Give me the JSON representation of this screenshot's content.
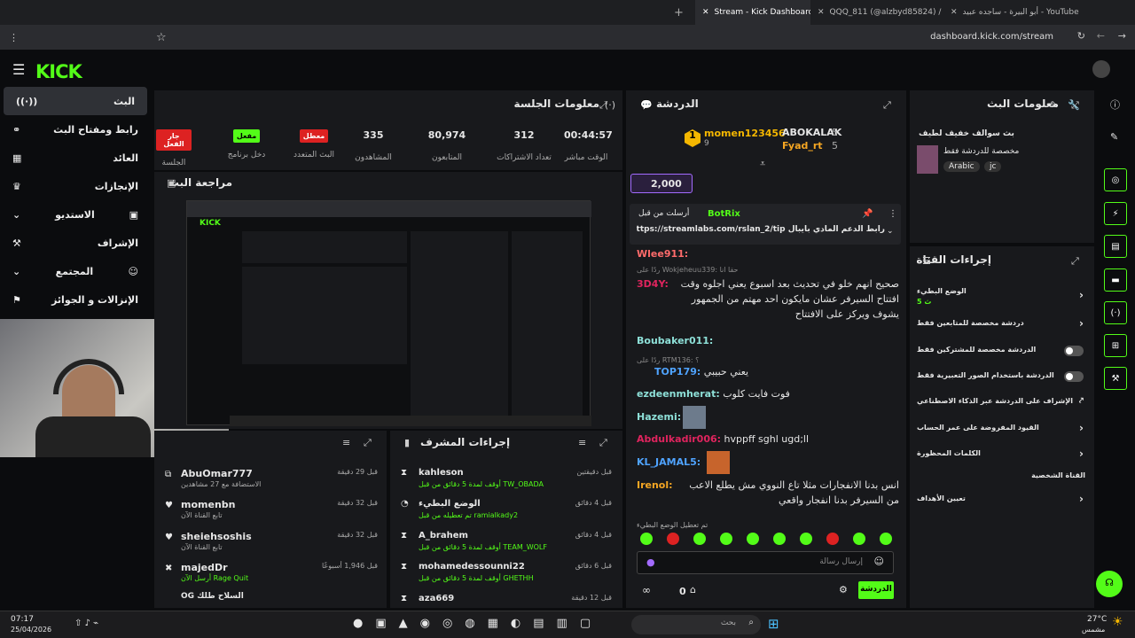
{
  "browser": {
    "tabs": [
      {
        "label": "أبو البيرة - ساجده عبيد - YouTube"
      },
      {
        "label": "QQQ_811 (@alzbyd85824) / X"
      },
      {
        "label": "Stream - Kick Dashboard"
      }
    ],
    "url": "dashboard.kick.com/stream"
  },
  "nav": [
    {
      "label": "البث"
    },
    {
      "label": "رابط ومفتاح البث"
    },
    {
      "label": "العائد"
    },
    {
      "label": "الإنجازات"
    },
    {
      "label": "الاستديو"
    },
    {
      "label": "الإشراف"
    },
    {
      "label": "المجتمع"
    },
    {
      "label": "الإنزالات و الجوائز"
    }
  ],
  "session": {
    "title": "معلومات الجلسة",
    "stats": [
      {
        "value": "00:44:57",
        "label": "الوقت مباشر"
      },
      {
        "value": "312",
        "label": "تعداد الاشتراكات"
      },
      {
        "value": "80,974",
        "label": "المتابعون"
      },
      {
        "value": "335",
        "label": "المشاهدون"
      },
      {
        "badge": "معطل",
        "label": "البث المتعدد"
      },
      {
        "badge": "مفعل",
        "label": "دخل برنامج"
      },
      {
        "badge": "جار الفعل",
        "label": "الجلسة"
      }
    ]
  },
  "preview": {
    "title": "مراجعة البث"
  },
  "activity": [
    {
      "name": "AbuOmar777",
      "time": "قبل 29 دقيقة",
      "detail": "الاستضافة مع 27 مشاهدين"
    },
    {
      "name": "momenbn",
      "time": "قبل 32 دقيقة",
      "detail": "تابع القناة الآن"
    },
    {
      "name": "sheiehsoshis",
      "time": "قبل 32 دقيقة",
      "detail": "تابع القناة الآن"
    },
    {
      "name": "majedDr",
      "time": "قبل 1,946 أسبوعًا",
      "detail": "أرسل الآن Rage Quit"
    },
    {
      "name": "OG السلاح طلك",
      "time": "",
      "detail": ""
    }
  ],
  "modactions": {
    "title": "إجراءات المشرف",
    "items": [
      {
        "name": "kahleson",
        "time": "قبل دقيقتين",
        "detail": "أوقف لمدة 5 دقائق من قبل TW_OBADA"
      },
      {
        "name": "الوضع البطيء",
        "time": "قبل 4 دقائق",
        "detail": "تم تعطيله من قبل ramialkady2"
      },
      {
        "name": "A_brahem",
        "time": "قبل 4 دقائق",
        "detail": "أوقف لمدة 5 دقائق من قبل TEAM_WOLF"
      },
      {
        "name": "mohamedessounni22",
        "time": "قبل 6 دقائق",
        "detail": "أوقف لمدة 5 دقائق من قبل GHETHH"
      },
      {
        "name": "aza669",
        "time": "قبل 12 دقيقة",
        "detail": ""
      }
    ]
  },
  "chat": {
    "title": "الدردشة",
    "leader1": "momen123456",
    "leader1count": "9",
    "leader2": "ABOKALAK",
    "leader2count": "5",
    "leader3": "Fyad_rt",
    "leader3count": "5",
    "kicks": "2,000",
    "pinned_by": "أرسلت من قبل",
    "pinned_user": "BotRix",
    "pinned_text": "رابط الدعم المادي بايبال https://streamlabs.com/rslan_2/tip",
    "messages": [
      {
        "user": "Wlee911:",
        "text": "",
        "color": "#ff6b6b"
      },
      {
        "user": "3D4Y:",
        "text": "صحيح انهم خلو في تحديث بعد اسبوع يعني اجلوه وقت افتتاح السيرفر عشان مايكون احد مهتم من الجمهور يشوف ويركز على الافتتاح",
        "color": "#e0245e",
        "reply": "ردًا على Wokjeheuu339: حقا انا"
      },
      {
        "user": "Boubaker011:",
        "text": "",
        "color": "#8ee0d8"
      },
      {
        "user": "TOP179:",
        "text": "يعني حبيبي",
        "color": "#4fa3ff",
        "reply": "ردًا على RTM136: ؟"
      },
      {
        "user": "ezdeenmherat:",
        "text": "فوت فايت كلوب",
        "color": "#8ee0d8"
      },
      {
        "user": "Hazemi:",
        "text": "",
        "color": "#8ee0d8"
      },
      {
        "user": "Abdulkadir006:",
        "text": "hvppff sghl ugd;ll",
        "color": "#e0245e"
      },
      {
        "user": "KL_JAMAL5:",
        "text": "",
        "color": "#4fa3ff"
      },
      {
        "user": "Irenol:",
        "text": "انس بدنا الانفجارات مثلا تاع النووي مش يطلع الاعب من السيرفر بدنا انفجار واقعي",
        "color": "#f5a623"
      }
    ],
    "slowmode": "تم تعطيل الوضع البطيء",
    "input_placeholder": "إرسال رسالة",
    "send": "الدردشة",
    "viewers": "0"
  },
  "streaminfo": {
    "title": "معلومات البث",
    "stream_title": "بث سوالف خفيف لطيف",
    "category": "مخصصة للدردشة فقط",
    "tags": [
      "Arabic",
      "jc"
    ]
  },
  "channel": {
    "title": "إجراءات القناة",
    "items": [
      {
        "label": "الوضع البطيء",
        "sub": "5 ث"
      },
      {
        "label": "دردشة مخصصة للمتابعين فقط"
      },
      {
        "label": "الدردشة مخصصة للمشتركين فقط"
      },
      {
        "label": "الدردشة باستخدام الصور التعبيرية فقط"
      },
      {
        "label": "الإشراف على الدردشة عبر الذكاء الاصطناعي"
      },
      {
        "label": "القيود المفروضة على عمر الحساب"
      },
      {
        "label": "الكلمات المحظورة"
      },
      {
        "label": "القناة الشخصية"
      },
      {
        "label": "تعيين الأهداف"
      }
    ]
  },
  "taskbar": {
    "time": "07:17",
    "date": "25/04/2026",
    "search": "بحث",
    "weather": "27°C",
    "weather_sub": "مشمس"
  }
}
